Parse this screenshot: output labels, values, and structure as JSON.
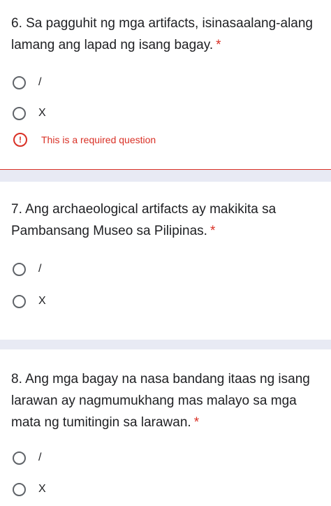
{
  "questions": [
    {
      "text": "6. Sa pagguhit ng mga artifacts, isinasaalang-alang lamang ang lapad ng isang bagay.",
      "required_mark": "*",
      "options": [
        "/",
        "X"
      ],
      "error": "This is a required question",
      "error_icon": "!"
    },
    {
      "text": "7. Ang archaeological artifacts ay makikita sa Pambansang Museo sa Pilipinas.",
      "required_mark": "*",
      "options": [
        "/",
        "X"
      ]
    },
    {
      "text": "8. Ang mga bagay na nasa bandang itaas ng isang larawan ay nagmumukhang mas malayo sa mga mata ng tumitingin sa larawan.",
      "required_mark": "*",
      "options": [
        "/",
        "X"
      ]
    }
  ],
  "colors": {
    "error": "#d93025",
    "text": "#202124",
    "radio_border": "#5f6368",
    "section_gap": "#e8eaf4"
  }
}
